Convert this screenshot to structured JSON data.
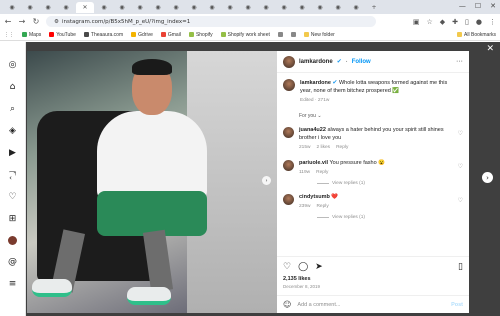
{
  "browser": {
    "url": "instagram.com/p/B5x5hM_p_eU/?img_index=1",
    "bookmarks": [
      {
        "label": "Maps",
        "color": "#34a853"
      },
      {
        "label": "YouTube",
        "color": "#ff0000"
      },
      {
        "label": "Theaaura.com",
        "color": "#4a4a4a"
      },
      {
        "label": "Gdrive",
        "color": "#f4b400"
      },
      {
        "label": "Gmail",
        "color": "#ea4335"
      },
      {
        "label": "Shopify",
        "color": "#95bf47"
      },
      {
        "label": "Shopify work sheet",
        "color": "#95bf47"
      },
      {
        "label": "",
        "color": "#888888"
      },
      {
        "label": "",
        "color": "#888888"
      },
      {
        "label": "New folder",
        "color": "#f2c94c"
      }
    ],
    "all_bookmarks": "All Bookmarks"
  },
  "post": {
    "username": "lamkardone",
    "follow_label": "Follow",
    "caption_user": "lamkardone",
    "caption_text": "Whole lotta weapons formed against me this year, none of them bitchez prospered ✅",
    "caption_edited": "Edited · 271w",
    "for_you": "For you",
    "comments": [
      {
        "user": "juana4u22",
        "text": "always a hater behind you your spirit still shines brother i love you",
        "age": "215w",
        "likes": "2 likes",
        "reply": "Reply"
      },
      {
        "user": "pariuole.vil",
        "text": "You pressure fasho 😮",
        "age": "119w",
        "likes": "",
        "reply": "Reply",
        "view_replies": "View replies (1)"
      },
      {
        "user": "cindytsumb",
        "text": "❤️",
        "age": "239w",
        "likes": "",
        "reply": "Reply",
        "view_replies": "View replies (1)"
      }
    ],
    "likes_count": "2,135 likes",
    "date": "December 8, 2019",
    "add_comment_placeholder": "Add a comment...",
    "post_label": "Post"
  }
}
